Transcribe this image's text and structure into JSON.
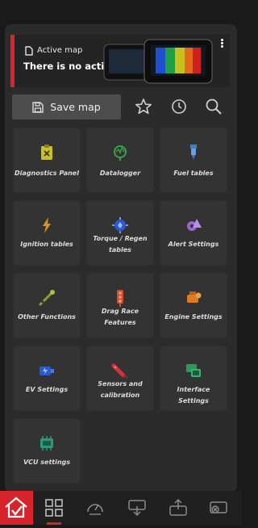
{
  "banner": {
    "label": "Active map",
    "title": "There is no active map"
  },
  "toolbar": {
    "save_label": "Save map",
    "icons": [
      "star-icon",
      "clock-icon",
      "search-icon"
    ]
  },
  "tiles": [
    {
      "label": "Diagnostics Panel",
      "icon": "diagnostics-clipboard-icon",
      "color": "#c8c21e"
    },
    {
      "label": "Datalogger",
      "icon": "datalogger-icon",
      "color": "#3aa04a"
    },
    {
      "label": "Fuel tables",
      "icon": "fuel-injector-icon",
      "color": "#3a7fd0"
    },
    {
      "label": "Ignition tables",
      "icon": "ignition-bolt-icon",
      "color": "#e0901e"
    },
    {
      "label": "Torque / Regen tables",
      "icon": "torque-regen-icon",
      "color": "#3a7fd0"
    },
    {
      "label": "Alert Settings",
      "icon": "alert-settings-icon",
      "color": "#9a6ad0"
    },
    {
      "label": "Other Functions",
      "icon": "other-functions-icon",
      "color": "#8aa030"
    },
    {
      "label": "Drag Race Features",
      "icon": "drag-race-tree-icon",
      "color": "#d84a2a"
    },
    {
      "label": "Engine Settings",
      "icon": "engine-icon",
      "color": "#e07a1e"
    },
    {
      "label": "EV Settings",
      "icon": "ev-motor-icon",
      "color": "#2a5ad0"
    },
    {
      "label": "Sensors and calibration",
      "icon": "sensor-icon",
      "color": "#d8303a"
    },
    {
      "label": "Interface Settings",
      "icon": "interface-icon",
      "color": "#2a9a5a"
    },
    {
      "label": "VCU settings",
      "icon": "vcu-icon",
      "color": "#2a9a7a"
    }
  ],
  "bottom_nav": {
    "items": [
      "home-icon",
      "grid-menu-icon",
      "dashboard-gauge-icon",
      "download-device-icon",
      "upload-device-icon",
      "disconnect-device-icon"
    ],
    "active": "grid-menu-icon",
    "accent": "#d8232a"
  }
}
